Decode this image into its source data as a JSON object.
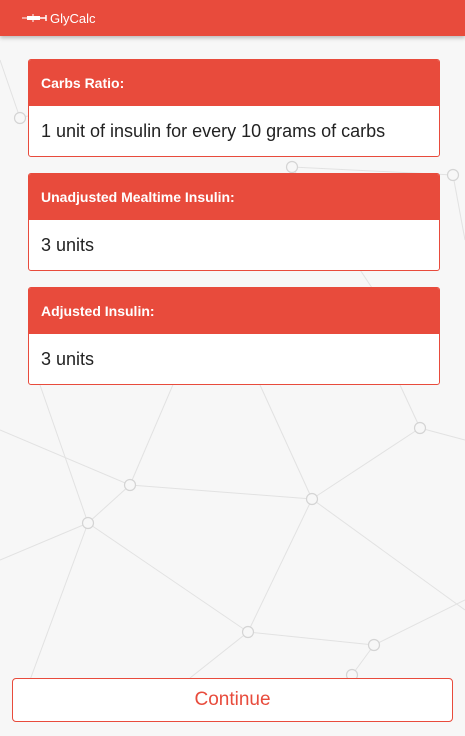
{
  "app": {
    "title": "GlyCalc",
    "icon": "syringe-icon",
    "accent_color": "#e84b3c"
  },
  "cards": [
    {
      "label": "Carbs Ratio:",
      "value": "1 unit of insulin for every 10 grams of carbs"
    },
    {
      "label": "Unadjusted Mealtime Insulin:",
      "value": "3 units"
    },
    {
      "label": "Adjusted Insulin:",
      "value": "3 units"
    }
  ],
  "continue_label": "Continue"
}
